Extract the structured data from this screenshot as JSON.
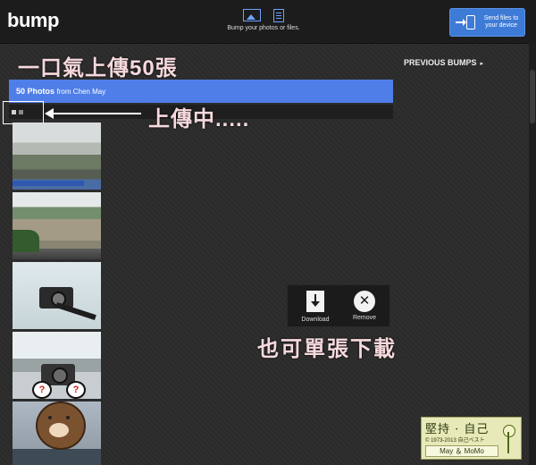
{
  "app": {
    "logo_text": "bump"
  },
  "header": {
    "center_label": "Bump your photos or files.",
    "send_button_label": "Send files to your device",
    "accent_color": "#3e7bd7"
  },
  "annotations": {
    "title": "一口氣上傳50張",
    "uploading": "上傳中.....",
    "single_download": "也可單張下載"
  },
  "nav": {
    "previous_bumps": "PREVIOUS BUMPS",
    "previous_bumps_arrow": "▸"
  },
  "banner": {
    "count_label": "50 Photos",
    "from_label": "from Chen May",
    "color": "#4f7ee8"
  },
  "toolbar": {
    "download_label": "Download",
    "remove_label": "Remove",
    "remove_glyph": "✕"
  },
  "thumbnails": [
    {
      "name": "photo-1"
    },
    {
      "name": "photo-2"
    },
    {
      "name": "photo-3"
    },
    {
      "name": "photo-4"
    },
    {
      "name": "photo-5"
    }
  ],
  "watermark": {
    "main": "堅持 · 自己",
    "sub": "© 1973-2013 自己ベスト",
    "names": "May ＆ MoMo"
  },
  "icons": {
    "photo": "photo-icon",
    "file": "file-icon",
    "send": "send-to-device-icon",
    "download": "download-icon",
    "remove": "remove-icon"
  }
}
